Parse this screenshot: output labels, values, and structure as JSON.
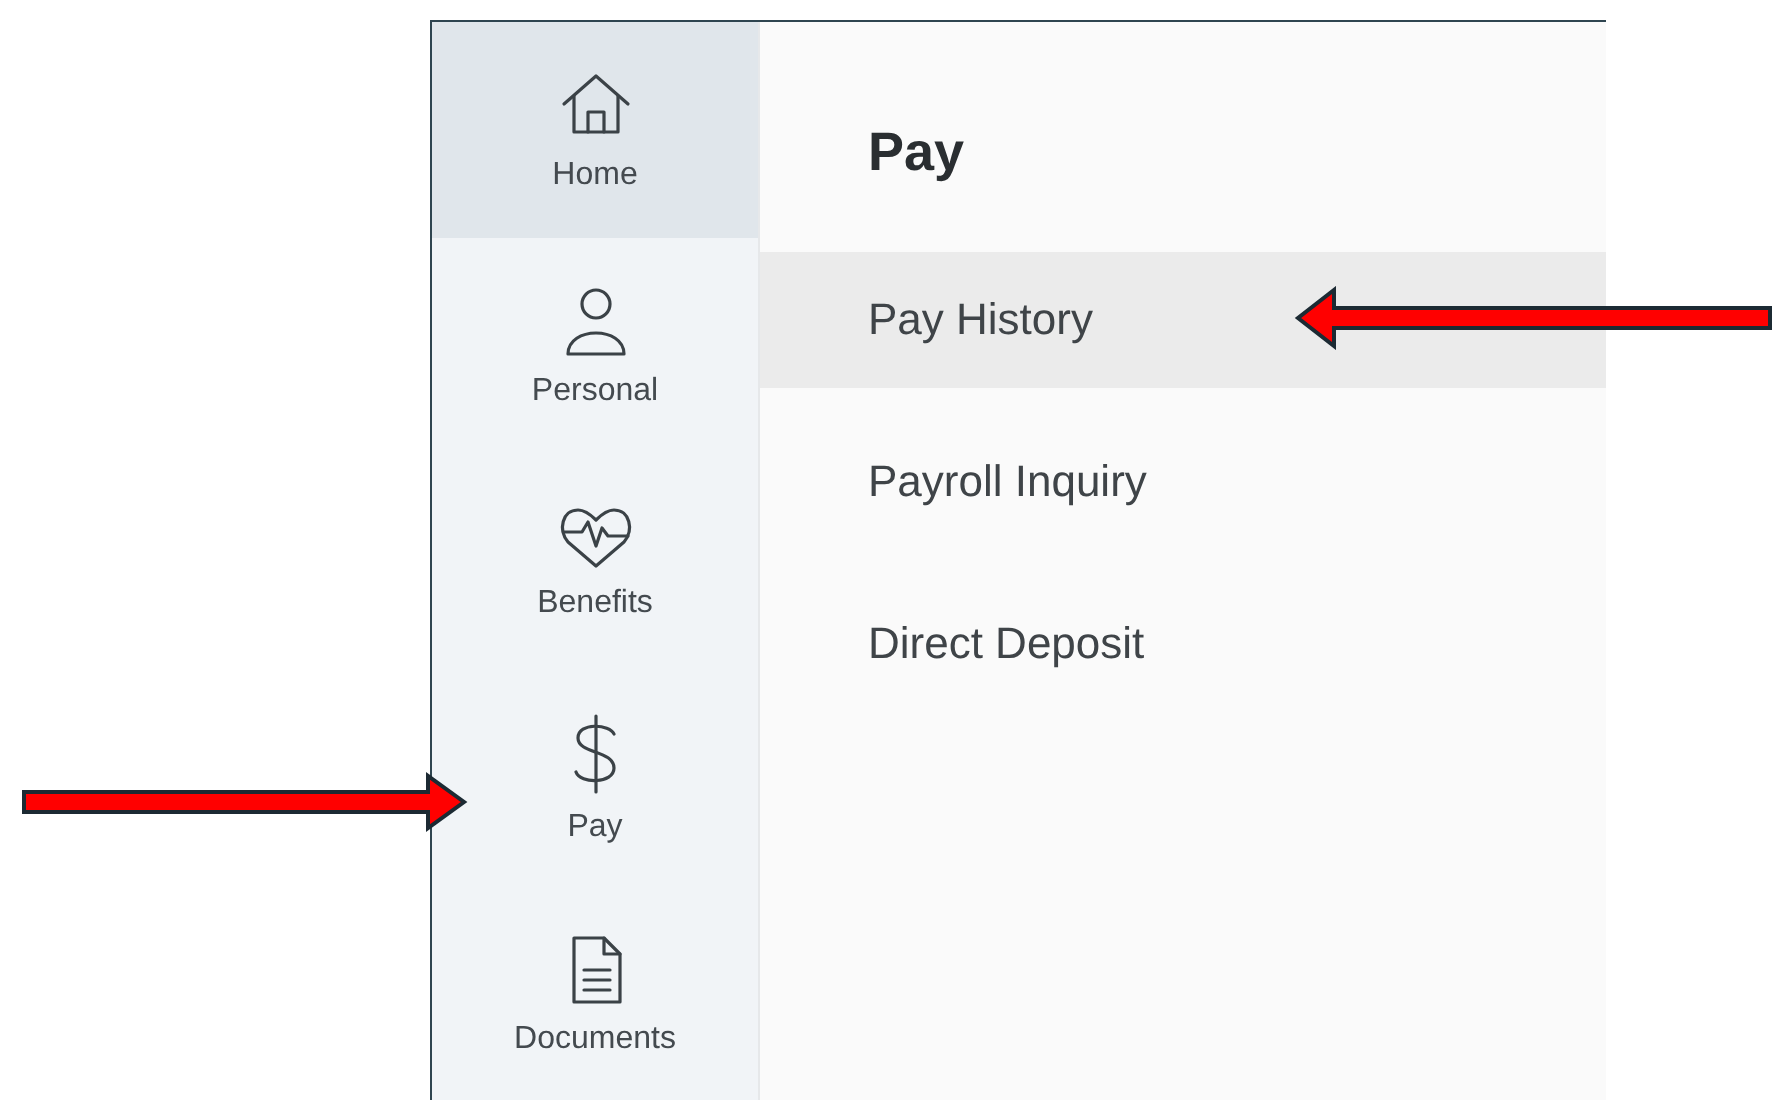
{
  "sidebar": {
    "items": [
      {
        "label": "Home",
        "kind": "home",
        "selected": true
      },
      {
        "label": "Personal",
        "kind": "person",
        "selected": false
      },
      {
        "label": "Benefits",
        "kind": "heart",
        "selected": false
      },
      {
        "label": "Pay",
        "kind": "dollar",
        "selected": false
      },
      {
        "label": "Documents",
        "kind": "document",
        "selected": false
      }
    ]
  },
  "panel": {
    "title": "Pay",
    "items": [
      {
        "label": "Pay History",
        "selected": true
      },
      {
        "label": "Payroll Inquiry",
        "selected": false
      },
      {
        "label": "Direct Deposit",
        "selected": false
      }
    ]
  }
}
